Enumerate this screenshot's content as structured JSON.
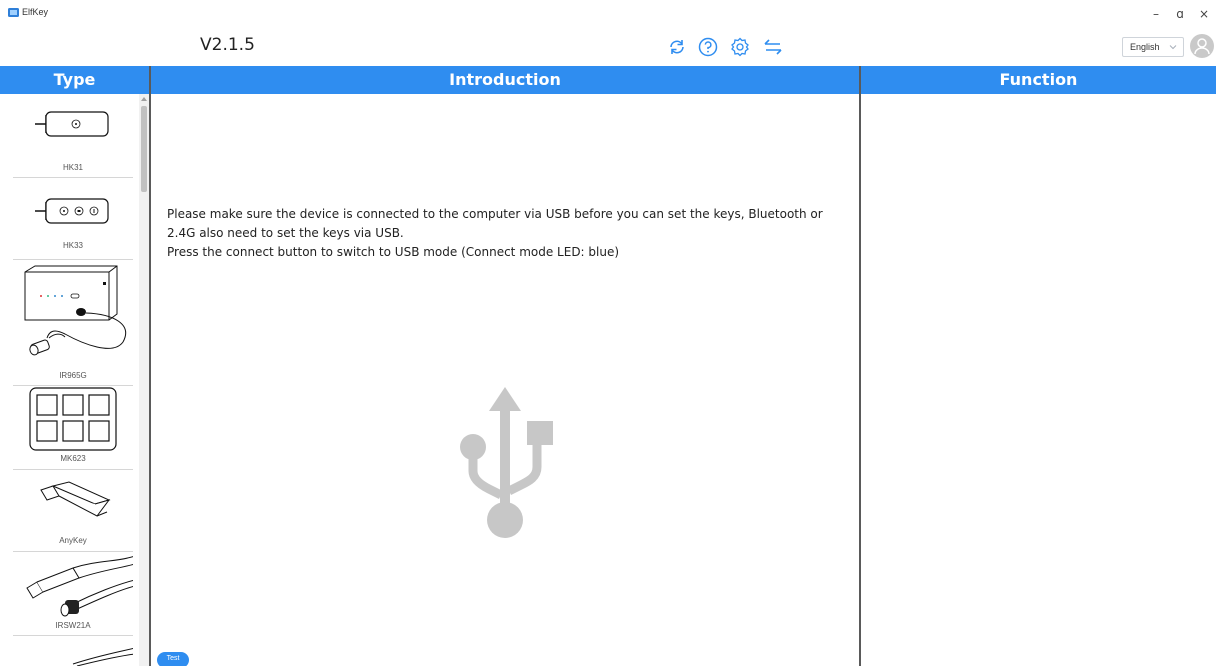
{
  "window": {
    "title": "ElfKey",
    "minimize": "–",
    "restore": "ɑ",
    "close": "×"
  },
  "header": {
    "version": "V2.1.5",
    "icons": [
      "refresh-icon",
      "help-icon",
      "settings-icon",
      "switch-icon"
    ],
    "language": "English",
    "accent": "#2f8df0"
  },
  "columns": {
    "type": "Type",
    "introduction": "Introduction",
    "function": "Function"
  },
  "devices": [
    {
      "label": "HK31"
    },
    {
      "label": "HK33"
    },
    {
      "label": "IR965G"
    },
    {
      "label": "MK623"
    },
    {
      "label": "AnyKey"
    },
    {
      "label": "IRSW21A"
    }
  ],
  "intro": {
    "line1": "Please make sure the device is connected to the computer via USB before you can set the keys, Bluetooth or",
    "line2": "2.4G also need to set the keys via USB.",
    "line3": "Press the connect button to switch to USB mode (Connect mode LED: blue)"
  },
  "footer": {
    "test_label": "Test"
  }
}
